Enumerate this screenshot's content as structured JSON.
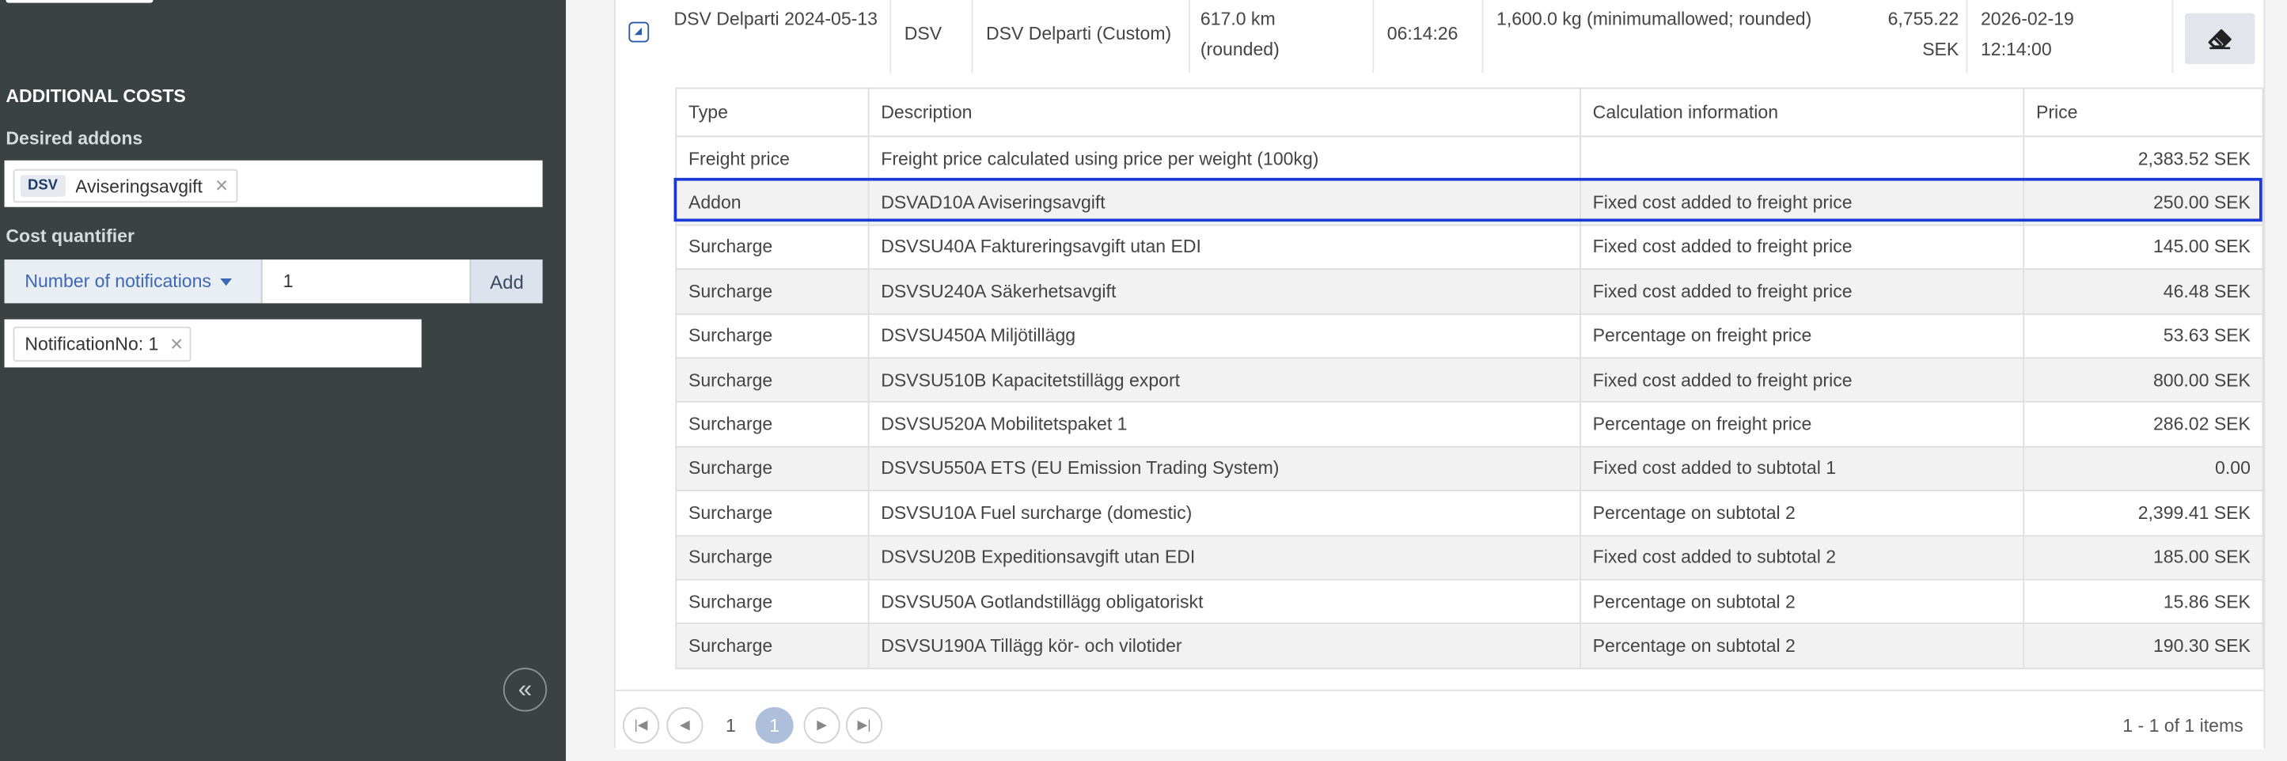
{
  "sidebar": {
    "section_title": "ADDITIONAL COSTS",
    "desired_addons_label": "Desired addons",
    "addon_tag": {
      "badge": "DSV",
      "label": "Aviseringsavgift"
    },
    "cost_quantifier_label": "Cost quantifier",
    "quantifier_select": "Number of notifications",
    "quantity_value": "1",
    "add_button": "Add",
    "notification_tag": "NotificationNo: 1"
  },
  "shipment": {
    "name": "DSV Delparti 2024-05-13",
    "carrier": "DSV",
    "service": "DSV Delparti (Custom)",
    "distance": "617.0 km (rounded)",
    "duration": "06:14:26",
    "weight": "1,600.0 kg (minimumallowed; rounded)",
    "price": "6,755.22 SEK",
    "datetime": "2026-02-19 12:14:00"
  },
  "table": {
    "headers": [
      "Type",
      "Description",
      "Calculation information",
      "Price"
    ],
    "rows": [
      [
        "Freight price",
        "Freight price calculated using price per weight (100kg)",
        "",
        "2,383.52 SEK"
      ],
      [
        "Addon",
        "DSVAD10A Aviseringsavgift",
        "Fixed cost added to freight price",
        "250.00 SEK"
      ],
      [
        "Surcharge",
        "DSVSU40A Faktureringsavgift utan EDI",
        "Fixed cost added to freight price",
        "145.00 SEK"
      ],
      [
        "Surcharge",
        "DSVSU240A Säkerhetsavgift",
        "Fixed cost added to freight price",
        "46.48 SEK"
      ],
      [
        "Surcharge",
        "DSVSU450A Miljötillägg",
        "Percentage on freight price",
        "53.63 SEK"
      ],
      [
        "Surcharge",
        "DSVSU510B Kapacitetstillägg export",
        "Fixed cost added to freight price",
        "800.00 SEK"
      ],
      [
        "Surcharge",
        "DSVSU520A Mobilitetspaket 1",
        "Percentage on freight price",
        "286.02 SEK"
      ],
      [
        "Surcharge",
        "DSVSU550A ETS (EU Emission Trading System)",
        "Fixed cost added to subtotal 1",
        "0.00"
      ],
      [
        "Surcharge",
        "DSVSU10A Fuel surcharge (domestic)",
        "Percentage on subtotal 2",
        "2,399.41 SEK"
      ],
      [
        "Surcharge",
        "DSVSU20B Expeditionsavgift utan EDI",
        "Fixed cost added to subtotal 2",
        "185.00 SEK"
      ],
      [
        "Surcharge",
        "DSVSU50A Gotlandstillägg obligatoriskt",
        "Percentage on subtotal 2",
        "15.86 SEK"
      ],
      [
        "Surcharge",
        "DSVSU190A Tillägg kör- och vilotider",
        "Percentage on subtotal 2",
        "190.30 SEK"
      ]
    ]
  },
  "pager": {
    "page_plain": "1",
    "page_active": "1",
    "info": "1 - 1 of 1 items"
  },
  "colors": {
    "sidebar_bg": "#3b4242",
    "highlight": "#1a38d8",
    "accent": "#3d68b5"
  }
}
